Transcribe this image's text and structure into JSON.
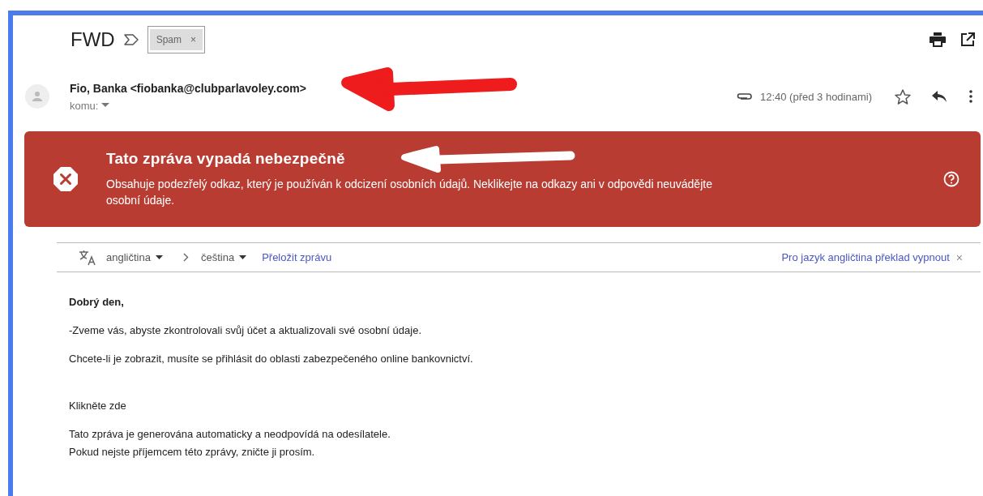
{
  "subject": "FWD",
  "labels": [
    {
      "text": "Spam",
      "remove": "×"
    }
  ],
  "sender": {
    "name": "Fio, Banka <fiobanka@clubparlavoley.com>",
    "to_label": "komu:",
    "time": "12:40 (před 3 hodinami)",
    "has_attachment": true,
    "starred": false
  },
  "warning": {
    "title": "Tato zpráva vypadá nebezpečně",
    "text": "Obsahuje podezřelý odkaz, který je používán k odcizení osobních údajů. Neklikejte na odkazy ani v odpovědi neuvádějte osobní údaje."
  },
  "translate": {
    "from": "angličtina",
    "to": "čeština",
    "action": "Přeložit zprávu",
    "turn_off": "Pro jazyk angličtina překlad vypnout",
    "close": "×"
  },
  "body": [
    {
      "kind": "greeting",
      "text": "Dobrý den,"
    },
    {
      "kind": "paragraph",
      "text": "-Zveme vás, abyste zkontrolovali svůj účet a aktualizovali své osobní údaje."
    },
    {
      "kind": "paragraph",
      "text": "Chcete-li je zobrazit, musíte se přihlásit do oblasti zabezpečeného online bankovnictví."
    },
    {
      "kind": "spaced",
      "text": "Klikněte zde"
    },
    {
      "kind": "paragraph",
      "text": "Tato zpráva je generována automaticky a neodpovídá na odesílatele."
    },
    {
      "kind": "continuation",
      "text": "Pokud nejste příjemcem této zprávy, zničte ji prosím."
    }
  ],
  "annotations": [
    {
      "kind": "arrow",
      "color": "#ee1c1c"
    },
    {
      "kind": "arrow",
      "color": "#ffffff"
    }
  ]
}
